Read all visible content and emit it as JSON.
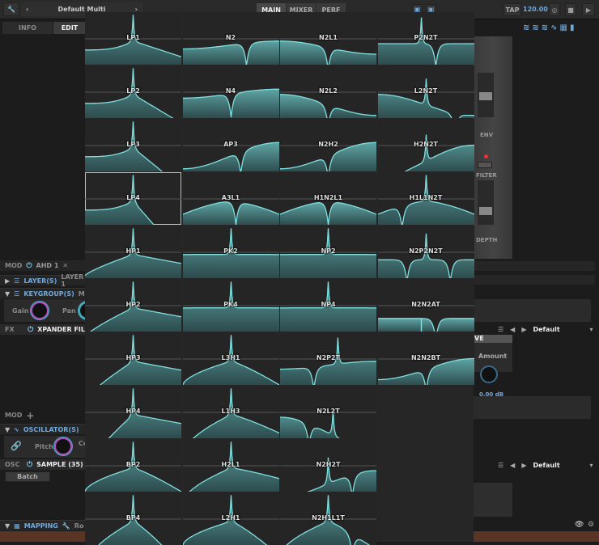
{
  "topbar": {
    "program": "Default Multi",
    "tabs": [
      "MAIN",
      "MIXER",
      "PERF"
    ],
    "tap": "TAP",
    "bpm": "120.00"
  },
  "left": {
    "tabs": [
      "INFO",
      "EDIT"
    ],
    "mod_row": {
      "label": "MOD",
      "item": "AHD 1"
    },
    "layers": {
      "label": "LAYER(S)",
      "value": "LAYER 1"
    },
    "keygroups": {
      "label": "KEYGROUP(S)",
      "value": "MU"
    },
    "gain": "Gain",
    "pan": "Pan",
    "fx_row": {
      "label": "FX",
      "item": "XPANDER FIL"
    },
    "mod2": "MOD",
    "osc_section": "OSCILLATOR(S)",
    "pitch": "Pitch",
    "coarse": "Co",
    "osc_row": {
      "label": "OSC",
      "item": "SAMPLE (35)"
    },
    "batch": "Batch",
    "mapping": {
      "label": "MAPPING",
      "value": "Ro"
    }
  },
  "right": {
    "env": "ENV",
    "filter": "FILTER",
    "depth": "DEPTH",
    "preset1": "Default",
    "preset2": "Default",
    "ve": "VE",
    "amount": "Amount",
    "amount_value": "0.00 dB"
  },
  "filter_popup": {
    "selected": "LP4",
    "columns": [
      [
        "LP1",
        "LP2",
        "LP3",
        "LP4",
        "HP1",
        "HP2",
        "HP3",
        "HP4",
        "BP2",
        "BP4"
      ],
      [
        "N2",
        "N4",
        "AP3",
        "A3L1",
        "PK2",
        "PK4",
        "L3H1",
        "L1H3",
        "H2L1",
        "L2H1"
      ],
      [
        "N2L1",
        "N2L2",
        "N2H2",
        "H1N2L1",
        "NP2",
        "NP4",
        "N2P2T",
        "N2L2T",
        "N2H2T",
        "N2H1L1T"
      ],
      [
        "P2N2T",
        "L2N2T",
        "H2N2T",
        "H1L1N2T",
        "N2P2N2T",
        "N2N2AT",
        "N2N2BT"
      ]
    ]
  },
  "colors": {
    "curve": "#7fe0e0",
    "fill_top": "#5fa4a4",
    "fill_bottom": "#2c4a4c",
    "accent": "#6fa8dc"
  }
}
